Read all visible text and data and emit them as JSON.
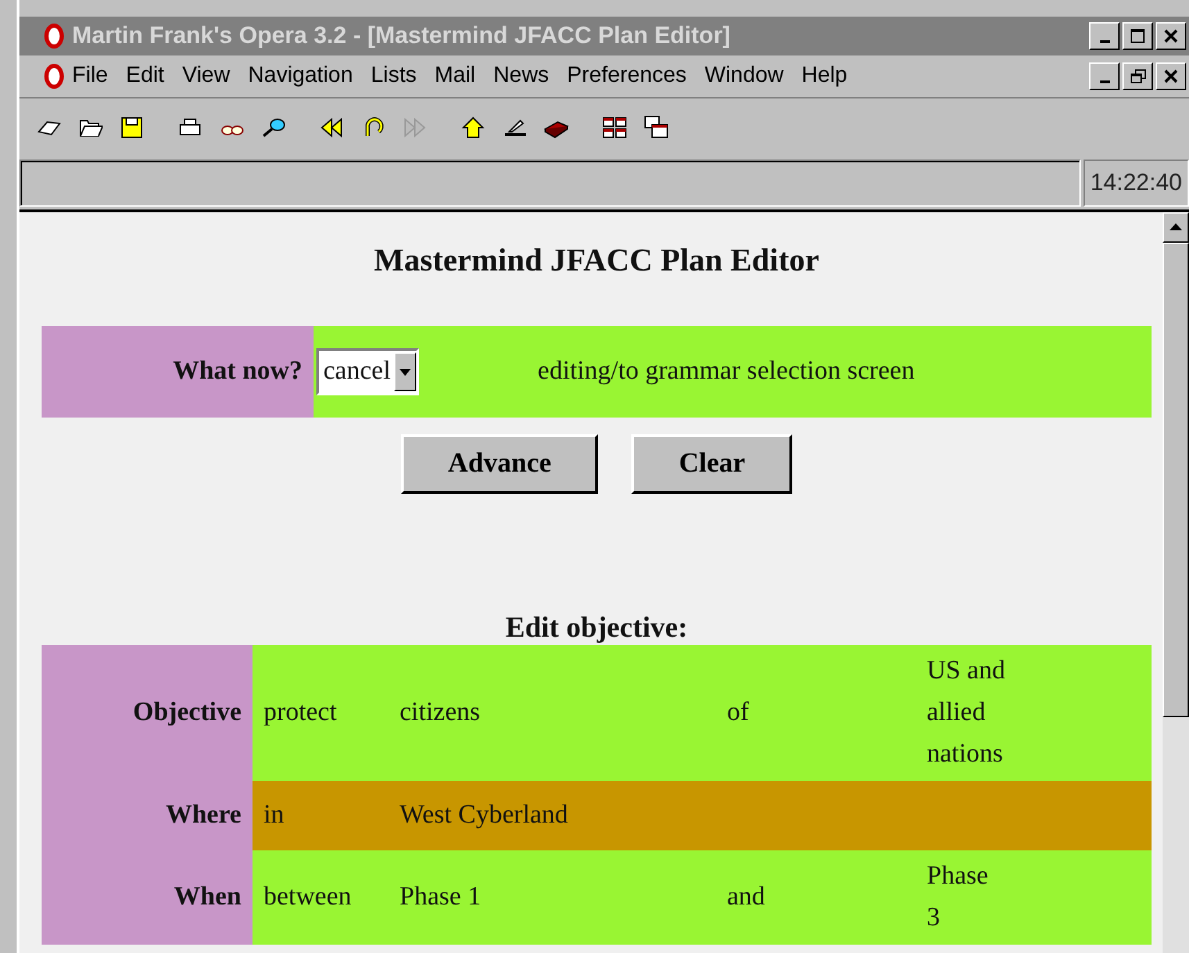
{
  "window": {
    "title": "Martin Frank's Opera 3.2 - [Mastermind JFACC Plan Editor]"
  },
  "menu": [
    {
      "label": "File"
    },
    {
      "label": "Edit"
    },
    {
      "label": "View"
    },
    {
      "label": "Navigation"
    },
    {
      "label": "Lists"
    },
    {
      "label": "Mail"
    },
    {
      "label": "News"
    },
    {
      "label": "Preferences"
    },
    {
      "label": "Window"
    },
    {
      "label": "Help"
    }
  ],
  "address_bar": {
    "clock": "14:22:40"
  },
  "page": {
    "heading": "Mastermind JFACC Plan Editor",
    "action": {
      "label": "What now?",
      "select_value": "cancel",
      "description": "editing/to grammar selection screen"
    },
    "buttons": [
      "Advance",
      "Clear"
    ],
    "section_heading": "Edit objective:",
    "table": {
      "rows": [
        {
          "label": "Objective",
          "color": "#99f533",
          "cells": [
            "protect",
            "citizens",
            "of",
            "US and allied nations"
          ]
        },
        {
          "label": "Where",
          "color": "#c89600",
          "cells": [
            "in",
            "West Cyberland"
          ]
        },
        {
          "label": "When",
          "color": "#99f533",
          "cells": [
            "between",
            "Phase 1",
            "and",
            "Phase 3"
          ]
        }
      ]
    }
  }
}
